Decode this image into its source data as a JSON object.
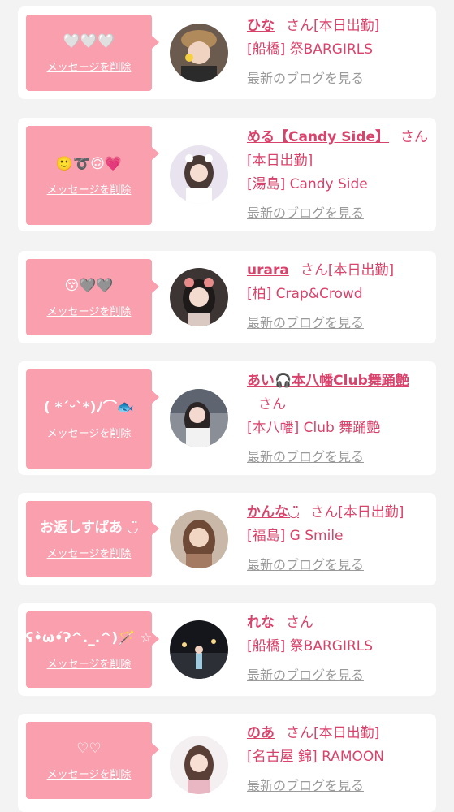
{
  "colors": {
    "accent_pink": "#f99fae",
    "name_pink": "#d8436b",
    "link_gray": "#9a9a9a",
    "background": "#f3f3f3"
  },
  "labels": {
    "san": "さん",
    "working_today": "[本日出勤]",
    "delete_message": "メッセージを削除",
    "blog_link": "最新のブログを見る"
  },
  "entries": [
    {
      "message": "🤍🤍🤍",
      "name": "ひな",
      "status": "[本日出勤]",
      "shop": "[船橋] 祭BARGIRLS",
      "blog": "最新のブログを見る",
      "delete": "メッセージを削除"
    },
    {
      "message": "🙂➰🙃💗",
      "name": "める【Candy Side】",
      "status": "[本日出勤]",
      "shop": "[湯島] Candy Side",
      "blog": "最新のブログを見る",
      "delete": "メッセージを削除"
    },
    {
      "message": "😚🩶🩶",
      "name": "urara",
      "status": "[本日出勤]",
      "shop": "[柏] Crap&Crowd",
      "blog": "最新のブログを見る",
      "delete": "メッセージを削除"
    },
    {
      "message": "( *ˊᵕˋ*)ﾉ⌒🐟",
      "name": "あい🎧本八幡Club舞踊艶",
      "status": "",
      "shop": "[本八幡] Club 舞踊艶",
      "blog": "最新のブログを見る",
      "delete": "メッセージを削除"
    },
    {
      "message": "お返しすぱあ ◡̈",
      "name": "かんな◡̈",
      "status": "[本日出勤]",
      "shop": "[福島] G Smile",
      "blog": "最新のブログを見る",
      "delete": "メッセージを削除"
    },
    {
      "message": "ʕ•̀ω•́ʔ^._.^)🪄 ☆",
      "name": "れな",
      "status": "",
      "shop": "[船橋] 祭BARGIRLS",
      "blog": "最新のブログを見る",
      "delete": "メッセージを削除"
    },
    {
      "message": "♡♡",
      "name": "のあ",
      "status": "[本日出勤]",
      "shop": "[名古屋 錦] RAMOON",
      "blog": "最新のブログを見る",
      "delete": "メッセージを削除"
    }
  ]
}
